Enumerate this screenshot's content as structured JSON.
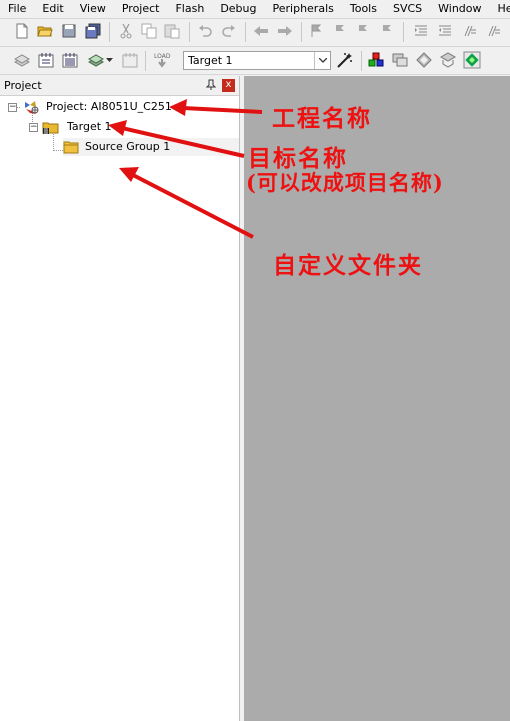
{
  "menu": [
    "File",
    "Edit",
    "View",
    "Project",
    "Flash",
    "Debug",
    "Peripherals",
    "Tools",
    "SVCS",
    "Window",
    "Help"
  ],
  "toolbar": {
    "target_select_value": "Target 1",
    "load_label": "LOAD"
  },
  "panel": {
    "title": "Project",
    "close_glyph": "x"
  },
  "tree": {
    "project": "Project: AI8051U_C251",
    "target": "Target 1",
    "group": "Source Group 1"
  },
  "annotations": {
    "project_name": "工程名称",
    "target_name_line1": "目标名称",
    "target_name_line2": "(可以改成项目名称)",
    "custom_folder": "自定义文件夹"
  },
  "colors": {
    "annotation": "#e11111",
    "workspace": "#ababab"
  }
}
